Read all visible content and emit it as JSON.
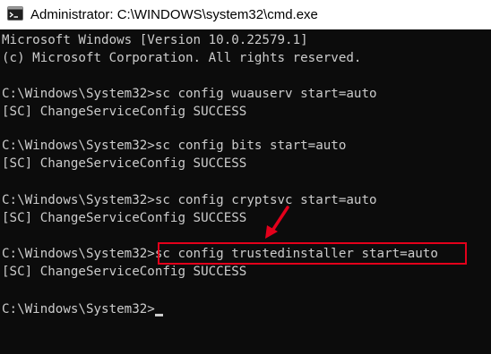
{
  "titlebar": {
    "title": "Administrator: C:\\WINDOWS\\system32\\cmd.exe",
    "icon": "terminal-icon"
  },
  "console": {
    "lines": [
      "Microsoft Windows [Version 10.0.22579.1]",
      "(c) Microsoft Corporation. All rights reserved.",
      "",
      "C:\\Windows\\System32>sc config wuauserv start=auto",
      "[SC] ChangeServiceConfig SUCCESS",
      "",
      "C:\\Windows\\System32>sc config bits start=auto",
      "[SC] ChangeServiceConfig SUCCESS",
      "",
      "C:\\Windows\\System32>sc config cryptsvc start=auto",
      "[SC] ChangeServiceConfig SUCCESS",
      "",
      "",
      "[SC] ChangeServiceConfig SUCCESS",
      "",
      ""
    ],
    "highlighted": {
      "prompt": "C:\\Windows\\System32>",
      "command": "sc config trustedinstaller start=auto"
    },
    "final_prompt": "C:\\Windows\\System32>"
  },
  "colors": {
    "background": "#0c0c0c",
    "text": "#cccccc",
    "annotation": "#e3001b"
  }
}
